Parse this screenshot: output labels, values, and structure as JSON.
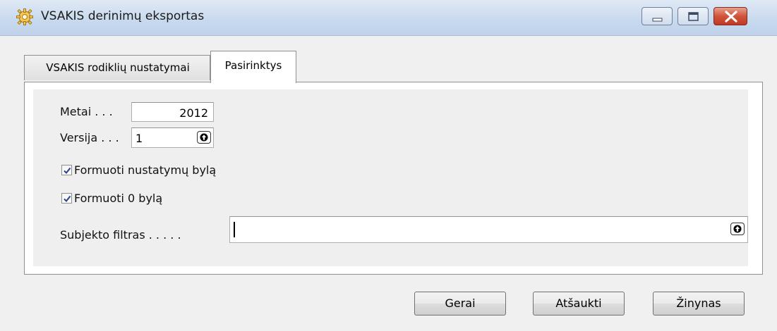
{
  "window": {
    "title": "VSAKIS derinimų eksportas",
    "icon": "gear-icon",
    "controls": {
      "minimize": "minimize-icon",
      "maximize": "maximize-icon",
      "close": "close-icon"
    },
    "close_color": "#c94a30"
  },
  "tabs": [
    {
      "label": "VSAKIS rodiklių nustatymai",
      "active": false
    },
    {
      "label": "Pasirinktys",
      "active": true
    }
  ],
  "form": {
    "year_label": "Metai . . .",
    "year_value": "2012",
    "version_label": "Versija . . .",
    "version_value": "1",
    "checkbox_settings_label": "Formuoti nustatymų bylą",
    "checkbox_settings_checked": true,
    "checkbox_zero_label": "Formuoti 0 bylą",
    "checkbox_zero_checked": true,
    "subject_filter_label": "Subjekto filtras . . . . .",
    "subject_filter_value": ""
  },
  "buttons": {
    "ok": "Gerai",
    "cancel": "Atšaukti",
    "help": "Žinynas"
  }
}
